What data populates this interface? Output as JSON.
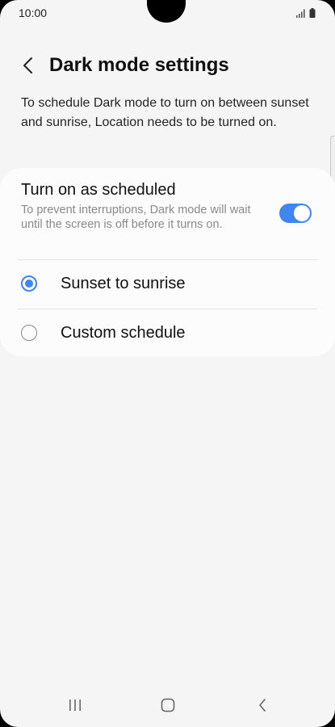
{
  "status_bar": {
    "time": "10:00",
    "icons": [
      "signal-icon",
      "battery-icon"
    ]
  },
  "header": {
    "title": "Dark mode settings",
    "back_icon": "chevron-left-icon"
  },
  "description": "To schedule Dark mode to turn on between sunset and sunrise, Location needs to be turned on.",
  "schedule": {
    "title": "Turn on as scheduled",
    "subtitle": "To prevent interruptions, Dark mode will wait until the screen is off before it turns on.",
    "toggle_on": true
  },
  "options": [
    {
      "label": "Sunset to sunrise",
      "selected": true
    },
    {
      "label": "Custom schedule",
      "selected": false
    }
  ],
  "nav_bar": {
    "icons": [
      "recent-apps-icon",
      "home-icon",
      "back-icon"
    ]
  },
  "colors": {
    "accent": "#3e87f0",
    "background": "#f5f5f5",
    "card": "#fcfcfc"
  }
}
